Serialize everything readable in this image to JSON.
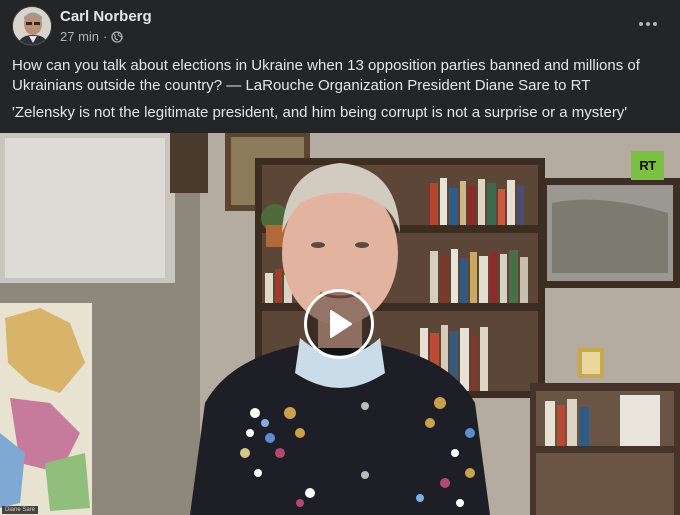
{
  "post": {
    "author": "Carl Norberg",
    "time": "27 min",
    "separator": "·",
    "privacy_icon": "globe-icon",
    "more_icon": "more-options-icon",
    "caption": "How can you talk about elections in Ukraine when 13 opposition parties banned and millions of Ukrainians outside the country? — LaRouche Organization President Diane Sare to RT",
    "quote": "'Zelensky is not the legitimate president, and him being corrupt is not a surprise or a mystery'"
  },
  "video": {
    "logo_text": "RT",
    "logo_color": "#7cc242",
    "play_icon": "play-icon",
    "name_tag": "Diane Sare"
  },
  "colors": {
    "background": "#242526",
    "primary_text": "#e4e6eb",
    "secondary_text": "#b0b3b8"
  }
}
